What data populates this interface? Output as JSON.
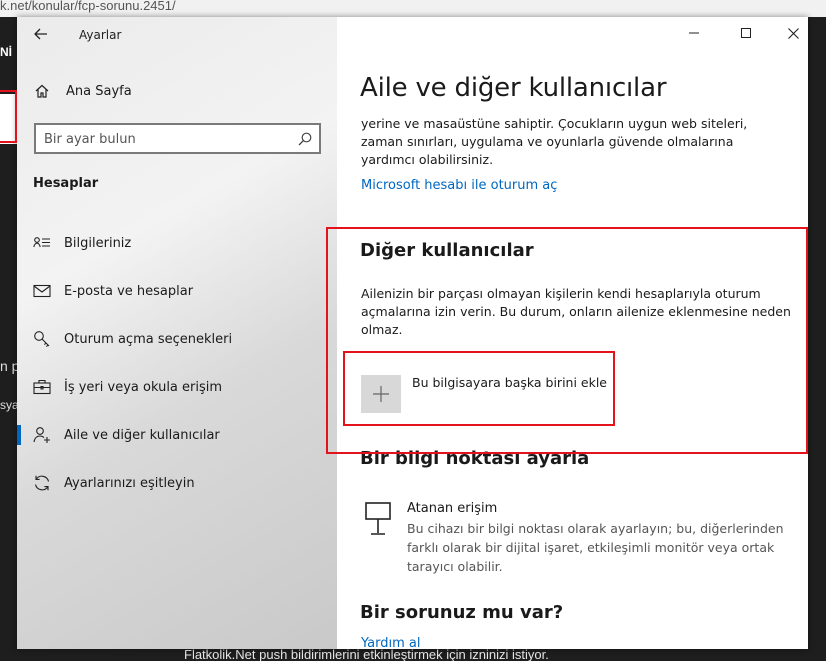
{
  "browser": {
    "url_fragment": "k.net/konular/fcp-sorunu.2451/",
    "notice": "Flatkolik.Net push bildirimlerini etkinleştirmek için izninizi istiyor.",
    "left_fragments": [
      "Nİ",
      "n p",
      "sya"
    ]
  },
  "window": {
    "app_title": "Ayarlar"
  },
  "sidebar": {
    "home_label": "Ana Sayfa",
    "search_placeholder": "Bir ayar bulun",
    "section_header": "Hesaplar",
    "items": [
      {
        "label": "Bilgileriniz",
        "icon": "person-card-icon"
      },
      {
        "label": "E-posta ve hesaplar",
        "icon": "mail-icon"
      },
      {
        "label": "Oturum açma seçenekleri",
        "icon": "key-icon"
      },
      {
        "label": "İş yeri veya okula erişim",
        "icon": "briefcase-icon"
      },
      {
        "label": "Aile ve diğer kullanıcılar",
        "icon": "person-add-icon",
        "active": true
      },
      {
        "label": "Ayarlarınızı eşitleyin",
        "icon": "sync-icon"
      }
    ]
  },
  "main": {
    "title": "Aile ve diğer kullanıcılar",
    "intro": "yerine ve masaüstüne sahiptir. Çocukların uygun web siteleri, zaman sınırları, uygulama ve oyunlarla güvende olmalarına yardımcı olabilirsiniz.",
    "ms_signin_link": "Microsoft hesabı ile oturum aç",
    "other_users": {
      "heading": "Diğer kullanıcılar",
      "description": "Ailenizin bir parçası olmayan kişilerin kendi hesaplarıyla oturum açmalarına izin verin. Bu durum, onların ailenize eklenmesine neden olmaz.",
      "add_label": "Bu bilgisayara başka birini ekle"
    },
    "kiosk": {
      "heading": "Bir bilgi noktası ayarla",
      "item_title": "Atanan erişim",
      "item_desc": "Bu cihazı bir bilgi noktası olarak ayarlayın; bu, diğerlerinden farklı olarak bir dijital işaret, etkileşimli monitör veya ortak tarayıcı olabilir."
    },
    "help": {
      "heading": "Bir sorunuz mu var?",
      "link": "Yardım al"
    }
  },
  "colors": {
    "accent": "#0067c0",
    "highlight": "#e3121b",
    "tile": "#d8d8d8"
  }
}
